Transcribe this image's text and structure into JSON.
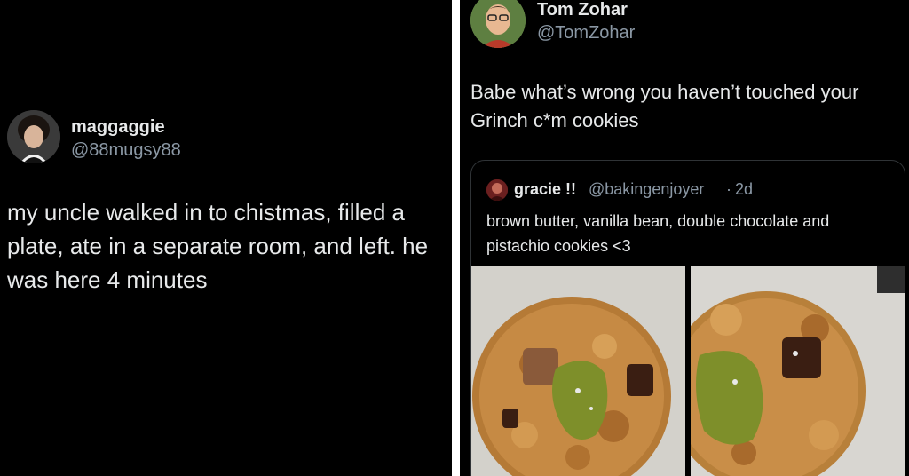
{
  "left_tweet": {
    "display_name": "maggaggie",
    "handle": "@88mugsy88",
    "text": "my uncle walked in to chistmas, filled a plate, ate in a separate room, and left. he was here 4 minutes"
  },
  "right_tweet": {
    "display_name": "Tom Zohar",
    "handle": "@TomZohar",
    "text": "Babe what’s wrong you haven’t touched your Grinch c*m cookies",
    "quote": {
      "display_name": "gracie !!",
      "handle": "@bakingenjoyer",
      "separator": "·",
      "time": "2d",
      "text": "brown butter, vanilla bean, double chocolate and pistachio cookies <3"
    }
  },
  "colors": {
    "background": "#000000",
    "primary_text": "#e7e9ea",
    "secondary_text": "#8b98a5",
    "card_border": "#2f3336"
  }
}
